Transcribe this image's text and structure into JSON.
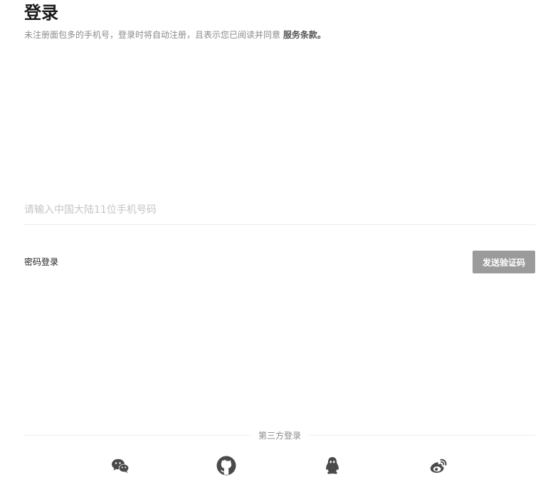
{
  "header": {
    "title": "登录",
    "subtitle_prefix": "未注册面包多的手机号，登录时将自动注册，且表示您已阅读并同意 ",
    "terms_link": "服务条款。"
  },
  "form": {
    "phone_placeholder": "请输入中国大陆11位手机号码",
    "phone_value": "",
    "password_login_label": "密码登录",
    "send_code_label": "发送验证码"
  },
  "third_party": {
    "label": "第三方登录",
    "providers": [
      {
        "name": "wechat",
        "icon": "wechat-icon"
      },
      {
        "name": "github",
        "icon": "github-icon"
      },
      {
        "name": "qq",
        "icon": "qq-icon"
      },
      {
        "name": "weibo",
        "icon": "weibo-icon"
      }
    ]
  },
  "colors": {
    "button_bg": "#9b9b9b",
    "icon": "#4a4a4a",
    "muted_text": "#8a8a8a"
  }
}
